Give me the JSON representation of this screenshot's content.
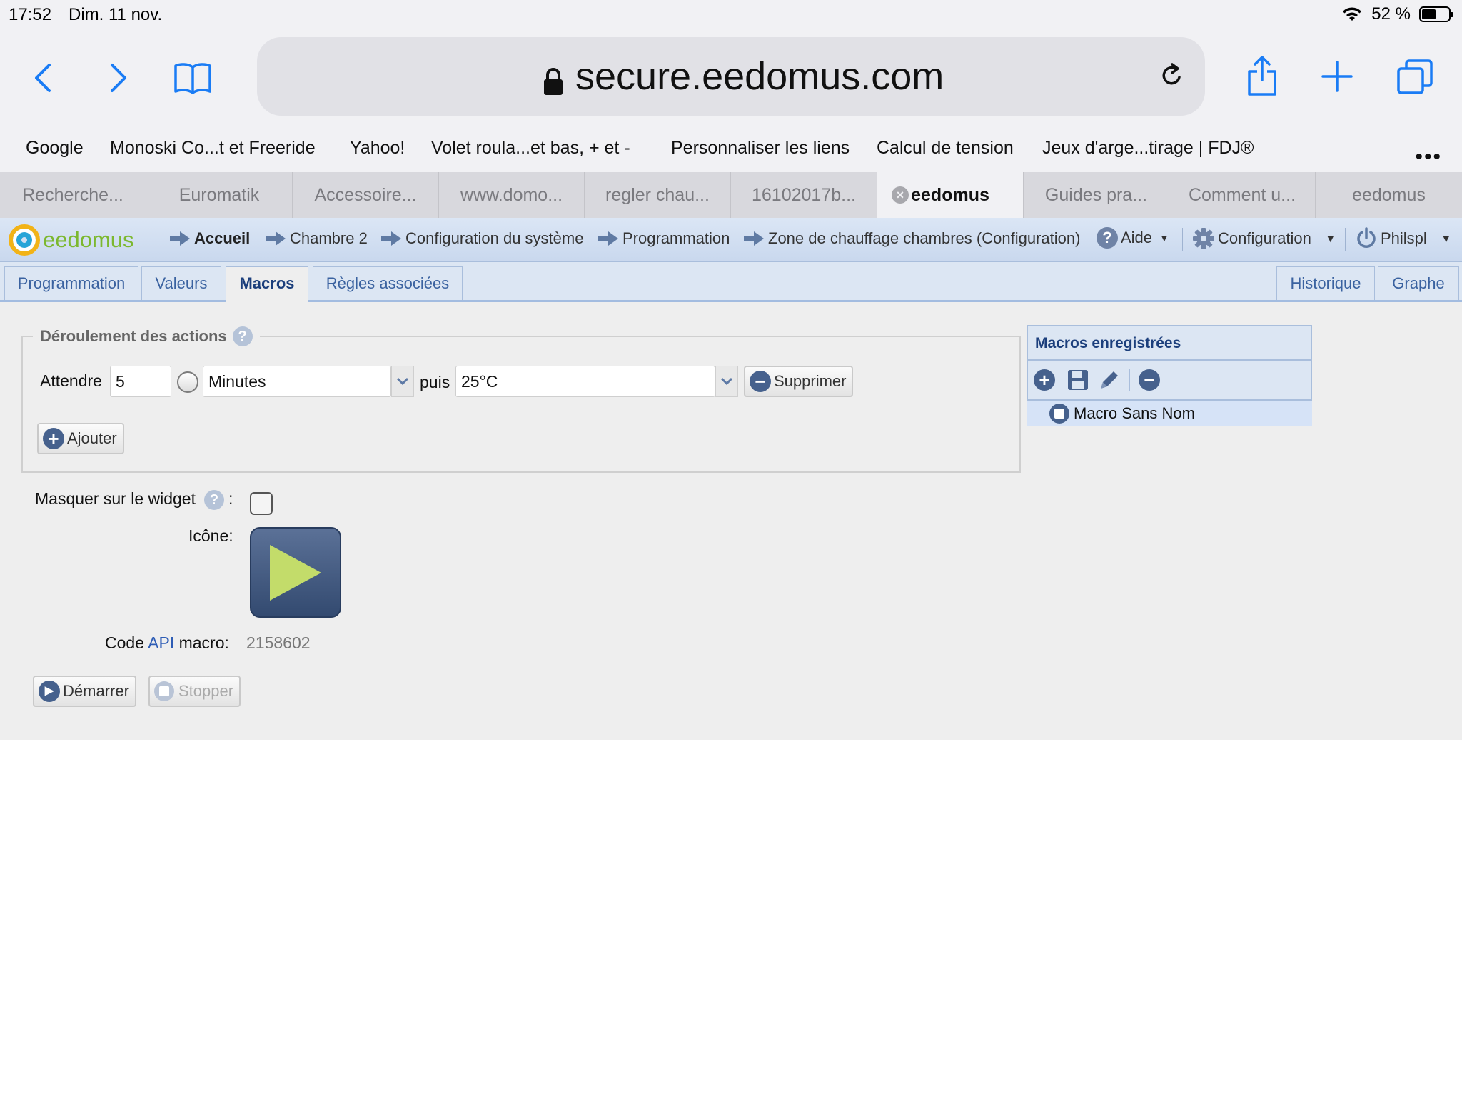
{
  "status": {
    "time": "17:52",
    "date": "Dim. 11 nov.",
    "battery": "52 %",
    "battery_level": 0.52
  },
  "browser": {
    "url": "secure.eedomus.com"
  },
  "bookmarks": [
    "Google",
    "Monoski Co...t et Freeride",
    "Yahoo!",
    "Volet roula...et bas, + et -",
    "Personnaliser les liens",
    "Calcul de tension",
    "Jeux d'arge...tirage | FDJ®"
  ],
  "tabs": [
    "Recherche...",
    "Euromatik",
    "Accessoire...",
    "www.domo...",
    "regler chau...",
    "16102017b...",
    "eedomus",
    "Guides pra...",
    "Comment u...",
    "eedomus"
  ],
  "app": {
    "logo_text": "eedomus",
    "breadcrumbs": [
      "Accueil",
      "Chambre 2",
      "Configuration du système",
      "Programmation",
      "Zone de chauffage chambres (Configuration)"
    ],
    "menu": {
      "help": "Aide",
      "config": "Configuration",
      "user": "Philspl"
    },
    "subtabs": [
      "Programmation",
      "Valeurs",
      "Macros",
      "Règles associées"
    ],
    "subtabs_right": [
      "Historique",
      "Graphe"
    ]
  },
  "actions": {
    "legend": "Déroulement des actions",
    "wait_label": "Attendre",
    "wait_value": "5",
    "unit": "Minutes",
    "then_label": "puis",
    "temp": "25°C",
    "delete": "Supprimer",
    "add": "Ajouter"
  },
  "widget": {
    "hide_label": "Masquer sur le widget",
    "colon": ":",
    "icon_label": "Icône:",
    "api_prefix": "Code ",
    "api_link": "API",
    "api_suffix": " macro:",
    "api_code": "2158602",
    "start": "Démarrer",
    "stop": "Stopper"
  },
  "macros_panel": {
    "title": "Macros enregistrées",
    "item": "Macro Sans Nom"
  }
}
